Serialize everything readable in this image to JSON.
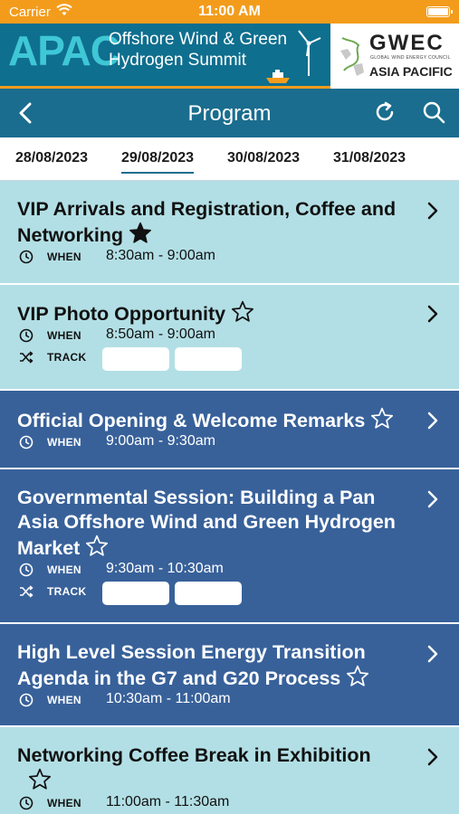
{
  "status_bar": {
    "carrier": "Carrier",
    "time": "11:00 AM"
  },
  "banner": {
    "event_short": "APAC",
    "event_line1": "Offshore Wind & Green",
    "event_line2": "Hydrogen Summit",
    "partner": "GWEC",
    "partner_tagline": "GLOBAL WIND ENERGY COUNCIL",
    "partner_region": "ASIA PACIFIC"
  },
  "nav": {
    "title": "Program"
  },
  "date_tabs": [
    {
      "label": "28/08/2023",
      "active": false
    },
    {
      "label": "29/08/2023",
      "active": true
    },
    {
      "label": "30/08/2023",
      "active": false
    },
    {
      "label": "31/08/2023",
      "active": false
    }
  ],
  "labels": {
    "when": "WHEN",
    "track": "TRACK"
  },
  "sessions": [
    {
      "title": "VIP Arrivals and Registration, Coffee and Networking",
      "when": "8:30am - 9:00am",
      "favorite": true,
      "has_track": false,
      "theme": "light"
    },
    {
      "title": "VIP Photo Opportunity",
      "when": "8:50am - 9:00am",
      "favorite": false,
      "has_track": true,
      "theme": "light"
    },
    {
      "title": "Official Opening & Welcome Remarks",
      "when": "9:00am - 9:30am",
      "favorite": false,
      "has_track": false,
      "theme": "dark"
    },
    {
      "title": "Governmental Session: Building a Pan Asia Offshore Wind and Green Hydrogen Market",
      "when": "9:30am - 10:30am",
      "favorite": false,
      "has_track": true,
      "theme": "dark"
    },
    {
      "title": "High Level Session Energy Transition Agenda in the G7 and G20 Process",
      "when": "10:30am - 11:00am",
      "favorite": false,
      "has_track": false,
      "theme": "dark"
    },
    {
      "title": "Networking Coffee Break in Exhibition",
      "when": "11:00am - 11:30am",
      "favorite": false,
      "has_track": false,
      "theme": "light"
    }
  ],
  "icons": {
    "back": "chevron-left-icon",
    "refresh": "refresh-icon",
    "search": "search-icon",
    "star_filled": "star-filled-icon",
    "star_outline": "star-outline-icon",
    "clock": "clock-icon",
    "shuffle": "shuffle-icon",
    "chevron": "chevron-right-icon"
  },
  "colors": {
    "status_bar": "#f39c1c",
    "header": "#1a6d8e",
    "light_row": "#b2dfe5",
    "dark_row": "#38619a"
  }
}
